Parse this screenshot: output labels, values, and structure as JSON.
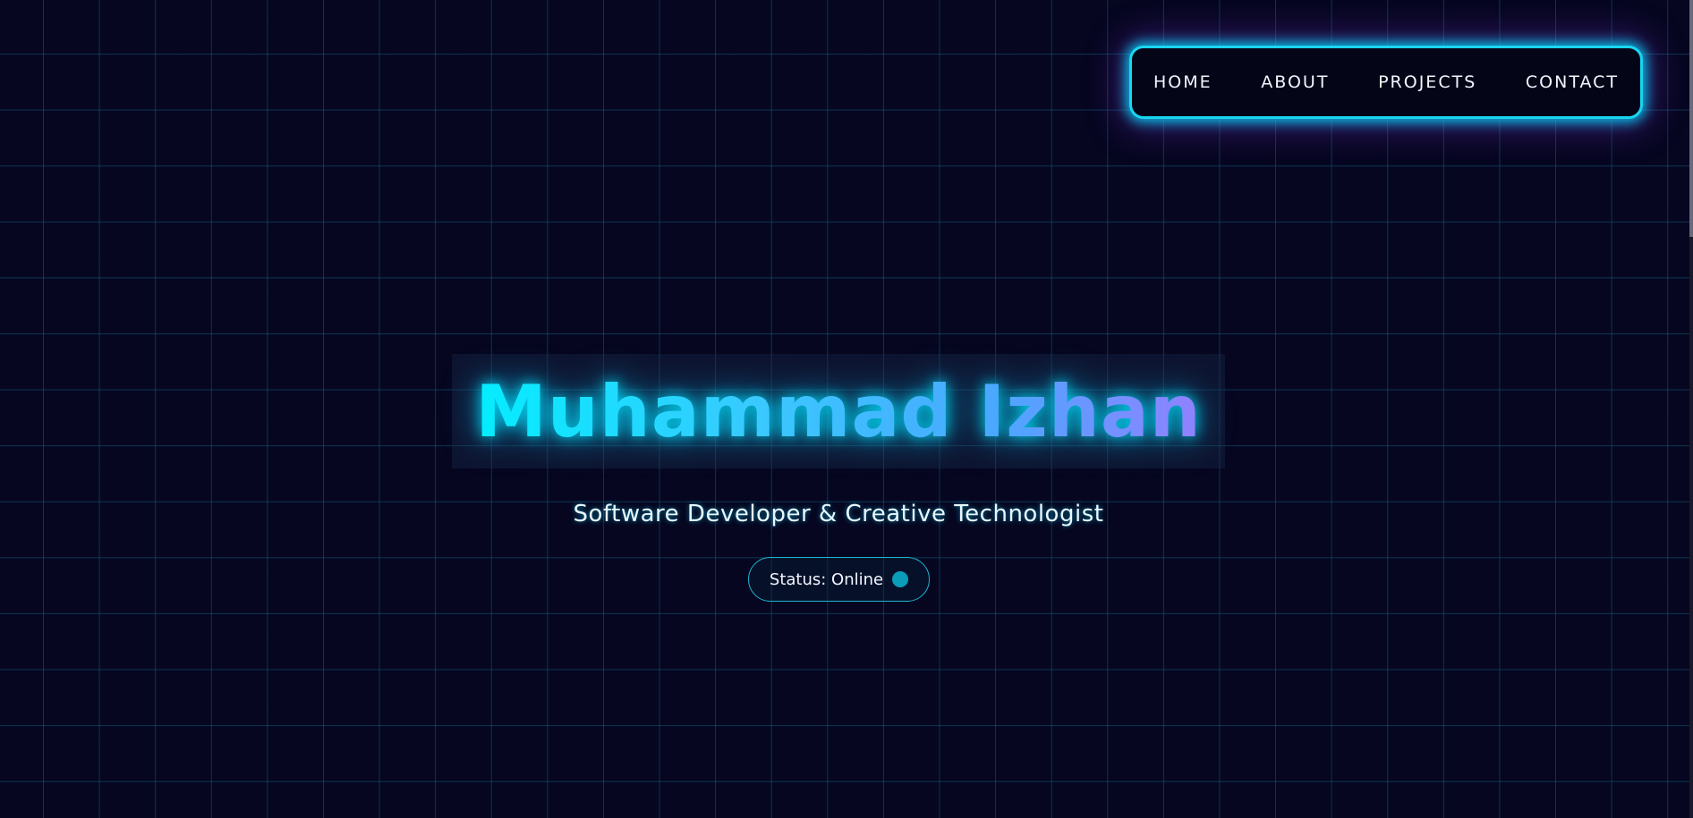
{
  "nav": {
    "items": [
      {
        "label": "HOME"
      },
      {
        "label": "ABOUT"
      },
      {
        "label": "PROJECTS"
      },
      {
        "label": "CONTACT"
      }
    ]
  },
  "hero": {
    "name": "Muhammad Izhan",
    "subtitle": "Software Developer & Creative Technologist",
    "status_label": "Status: Online"
  },
  "colors": {
    "background": "#060620",
    "grid": "#146e8c",
    "accent": "#19d6f0",
    "accent_secondary": "#9a7cff",
    "status_dot": "#0a9cb8"
  },
  "icons": {
    "status_indicator": "status-online-dot-icon"
  }
}
